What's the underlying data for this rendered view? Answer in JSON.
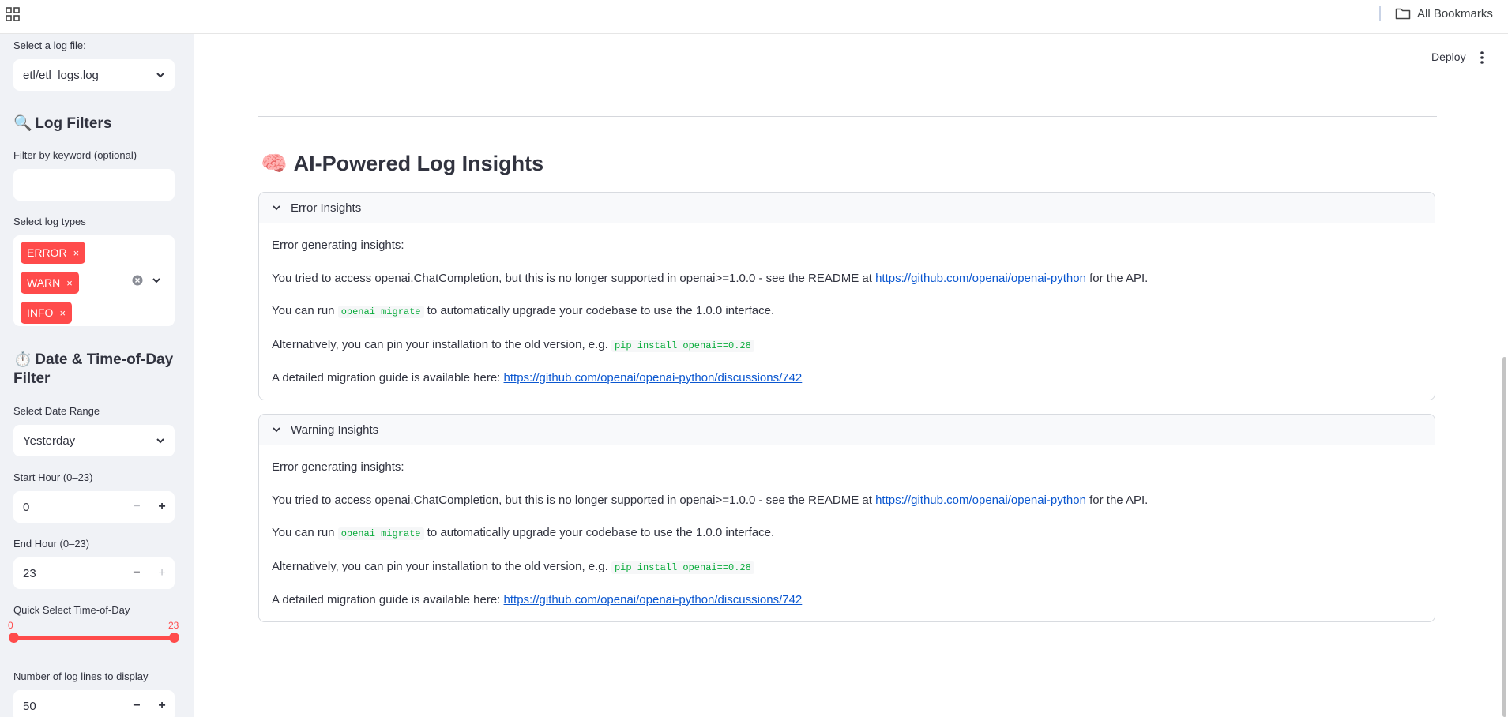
{
  "browser": {
    "bookmarks_label": "All Bookmarks",
    "icons": {
      "apps": "apps-grid-icon",
      "folder": "folder-icon"
    }
  },
  "sidebar": {
    "log_file": {
      "label": "Select a log file:",
      "value": "etl/etl_logs.log"
    },
    "filters_heading": {
      "emoji": "🔍",
      "text": "Log Filters"
    },
    "keyword": {
      "label": "Filter by keyword (optional)",
      "value": ""
    },
    "log_types": {
      "label": "Select log types",
      "chips": [
        "ERROR",
        "WARN",
        "INFO"
      ],
      "remove_glyph": "×"
    },
    "date_heading": {
      "emoji": "⏱️",
      "text": "Date & Time-of-Day Filter"
    },
    "date_range": {
      "label": "Select Date Range",
      "value": "Yesterday"
    },
    "start_hour": {
      "label": "Start Hour (0–23)",
      "value": "0"
    },
    "end_hour": {
      "label": "End Hour (0–23)",
      "value": "23"
    },
    "quick_select": {
      "label": "Quick Select Time-of-Day",
      "min_label": "0",
      "max_label": "23",
      "min": 0,
      "max": 23
    },
    "log_lines": {
      "label": "Number of log lines to display",
      "value": "50"
    },
    "stepper": {
      "minus": "−",
      "plus": "+"
    }
  },
  "main": {
    "deploy_label": "Deploy",
    "section_title": {
      "emoji": "🧠",
      "text": "AI-Powered Log Insights"
    },
    "expanders": [
      {
        "title": "Error Insights",
        "l1": "Error generating insights:",
        "l2a": "You tried to access openai.ChatCompletion, but this is no longer supported in openai>=1.0.0 - see the README at ",
        "l2link": "https://github.com/openai/openai-python",
        "l2b": " for the API.",
        "l3a": "You can run ",
        "l3code": "openai migrate",
        "l3b": " to automatically upgrade your codebase to use the 1.0.0 interface.",
        "l4a": "Alternatively, you can pin your installation to the old version, e.g. ",
        "l4code": "pip install openai==0.28",
        "l5a": "A detailed migration guide is available here: ",
        "l5link": "https://github.com/openai/openai-python/discussions/742"
      },
      {
        "title": "Warning Insights",
        "l1": "Error generating insights:",
        "l2a": "You tried to access openai.ChatCompletion, but this is no longer supported in openai>=1.0.0 - see the README at ",
        "l2link": "https://github.com/openai/openai-python",
        "l2b": " for the API.",
        "l3a": "You can run ",
        "l3code": "openai migrate",
        "l3b": " to automatically upgrade your codebase to use the 1.0.0 interface.",
        "l4a": "Alternatively, you can pin your installation to the old version, e.g. ",
        "l4code": "pip install openai==0.28",
        "l5a": "A detailed migration guide is available here: ",
        "l5link": "https://github.com/openai/openai-python/discussions/742"
      }
    ]
  },
  "colors": {
    "accent": "#ff4b4b",
    "link": "#0b57d0",
    "sidebar_bg": "#f0f2f6",
    "code": "#09ab3b"
  }
}
